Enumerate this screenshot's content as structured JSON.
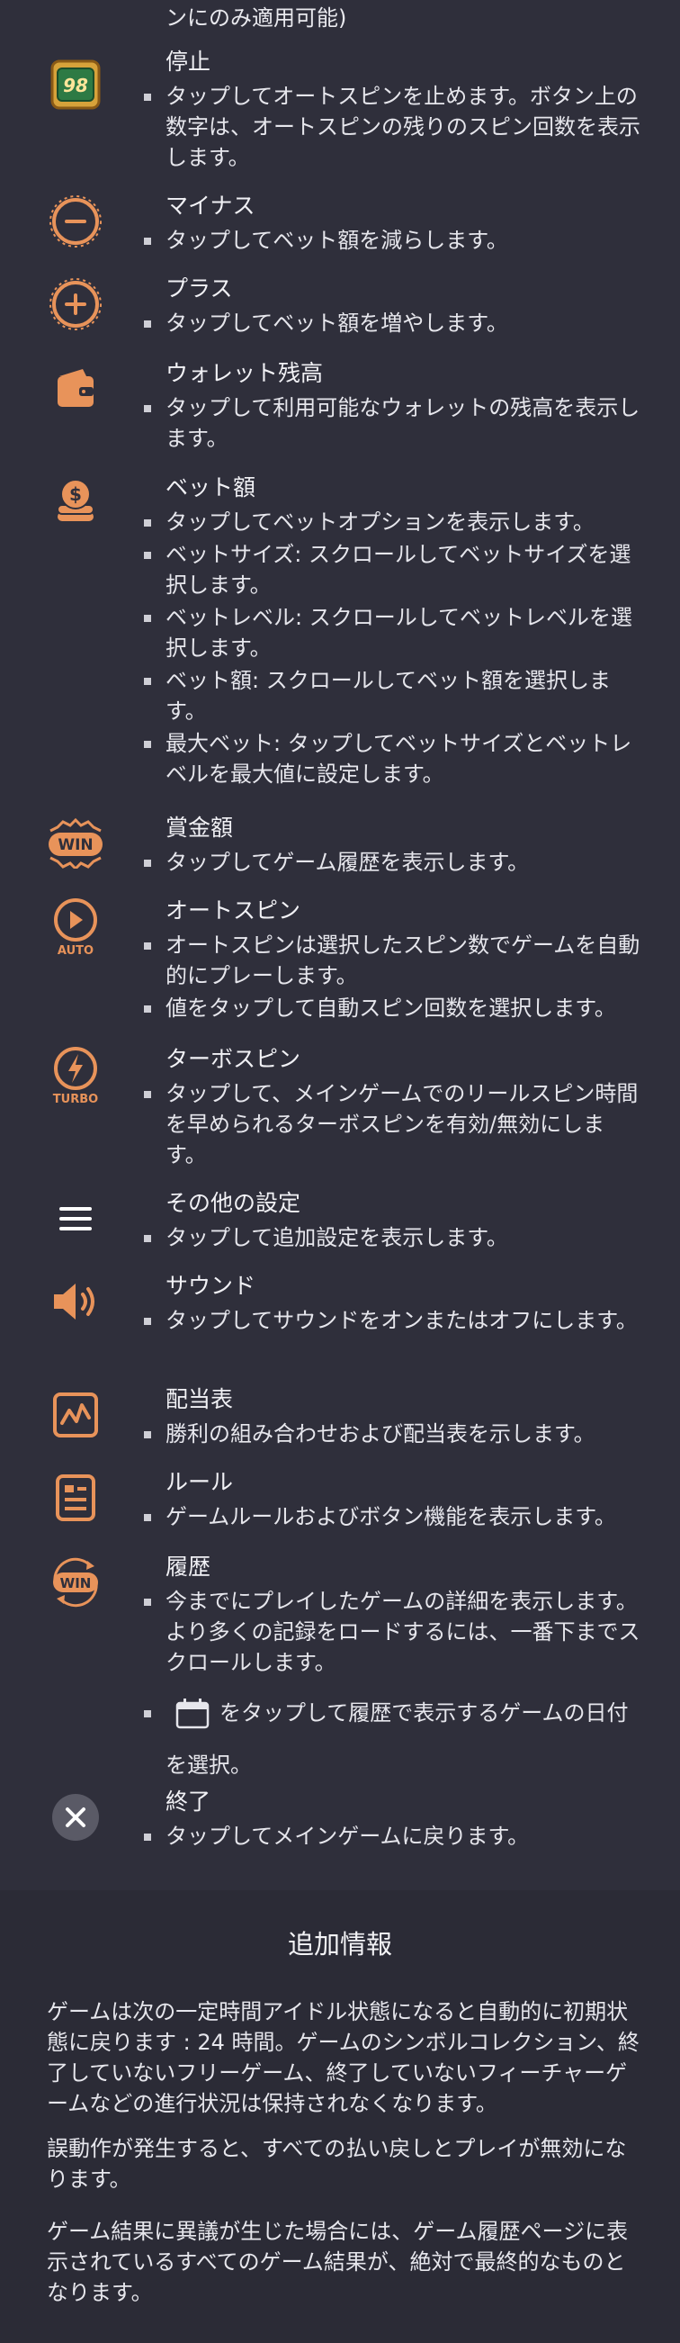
{
  "top_note": "ンにのみ適用可能)",
  "stop": {
    "badge": "98",
    "title": "停止",
    "bullets": [
      "タップしてオートスピンを止めます。ボタン上の数字は、オートスピンの残りのスピン回数を表示します。"
    ]
  },
  "minus": {
    "title": "マイナス",
    "bullets": [
      "タップしてベット額を減らします。"
    ]
  },
  "plus": {
    "title": "プラス",
    "bullets": [
      "タップしてベット額を増やします。"
    ]
  },
  "wallet": {
    "title": "ウォレット残高",
    "bullets": [
      "タップして利用可能なウォレットの残高を表示します。"
    ]
  },
  "bet": {
    "title": "ベット額",
    "bullets": [
      "タップしてベットオプションを表示します。",
      "ベットサイズ: スクロールしてベットサイズを選択します。",
      "ベットレベル: スクロールしてベットレベルを選択します。",
      "ベット額: スクロールしてベット額を選択します。",
      "最大ベット: タップしてベットサイズとベットレベルを最大値に設定します。"
    ]
  },
  "win": {
    "icon_text": "WIN",
    "title": "賞金額",
    "bullets": [
      "タップしてゲーム履歴を表示します。"
    ]
  },
  "autospin": {
    "icon_text": "AUTO",
    "title": "オートスピン",
    "bullets": [
      "オートスピンは選択したスピン数でゲームを自動的にプレーします。",
      "値をタップして自動スピン回数を選択します。"
    ]
  },
  "turbo": {
    "icon_text": "TURBO",
    "title": "ターボスピン",
    "bullets": [
      "タップして、メインゲームでのリールスピン時間を早められるターボスピンを有効/無効にします。"
    ]
  },
  "settings": {
    "title": "その他の設定",
    "bullets": [
      "タップして追加設定を表示します。"
    ]
  },
  "sound": {
    "title": "サウンド",
    "bullets": [
      "タップしてサウンドをオンまたはオフにします。"
    ]
  },
  "paytable": {
    "title": "配当表",
    "bullets": [
      "勝利の組み合わせおよび配当表を示します。"
    ]
  },
  "rules": {
    "title": "ルール",
    "bullets": [
      "ゲームルールおよびボタン機能を表示します。"
    ]
  },
  "history": {
    "icon_text": "WIN",
    "title": "履歴",
    "bullets": [
      "今までにプレイしたゲームの詳細を表示します。より多くの記録をロードするには、一番下までスクロールします。"
    ],
    "calendar_text": "をタップして履歴で表示するゲームの日付を選択。"
  },
  "exit": {
    "title": "終了",
    "bullets": [
      "タップしてメインゲームに戻ります。"
    ]
  },
  "extra": {
    "title": "追加情報",
    "paragraphs": [
      "ゲームは次の一定時間アイドル状態になると自動的に初期状態に戻ります : 24 時間。ゲームのシンボルコレクション、終了していないフリーゲーム、終了していないフィーチャーゲームなどの進行状況は保持されなくなります。",
      "誤動作が発生すると、すべての払い戻しとプレイが無効になります。",
      "ゲーム結果に異議が生じた場合には、ゲーム履歴ページに表示されているすべてのゲーム結果が、絶対で最終的なものとなります。"
    ]
  },
  "colors": {
    "accent": "#e8935a",
    "background": "#2f2f3b",
    "text": "#e9e9ee"
  }
}
